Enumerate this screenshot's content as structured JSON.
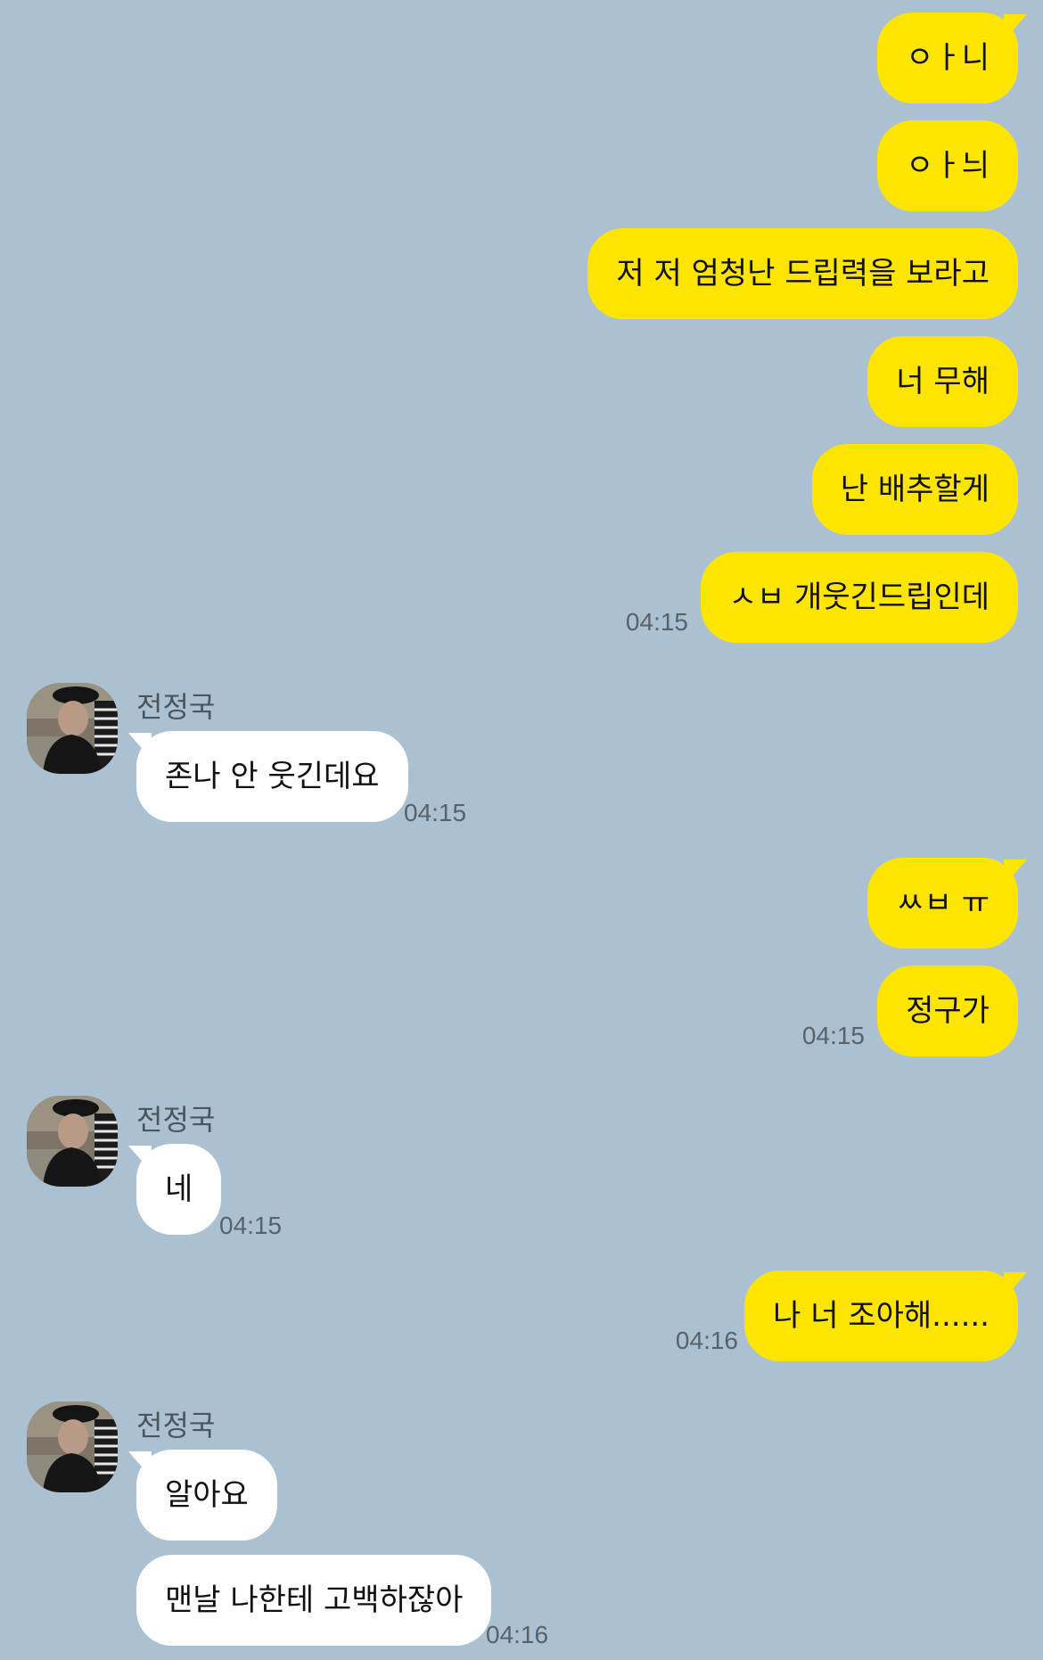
{
  "chat": {
    "sender_name": "전정국",
    "group1": {
      "m1": "ㅇㅏ니",
      "m2": "ㅇㅏ늬",
      "m3": "저 저 엄청난 드립력을 보라고",
      "m4": "너 무해",
      "m5": "난 배추할게",
      "m6": "ㅅㅂ 개웃긴드립인데",
      "time": "04:15"
    },
    "reply1": {
      "text": "존나 안 웃긴데요",
      "time": "04:15"
    },
    "group2": {
      "m1": "ㅆㅂ ㅠ",
      "m2": "정구가",
      "time": "04:15"
    },
    "reply2": {
      "text": "네",
      "time": "04:15"
    },
    "group3": {
      "m1": "나 너 조아해......",
      "time": "04:16"
    },
    "reply3": {
      "m1": "알아요",
      "m2": "맨날 나한테 고백하잖아",
      "time": "04:16"
    }
  },
  "colors": {
    "background": "#abc1d1",
    "my_bubble": "#fee500",
    "their_bubble": "#ffffff"
  }
}
